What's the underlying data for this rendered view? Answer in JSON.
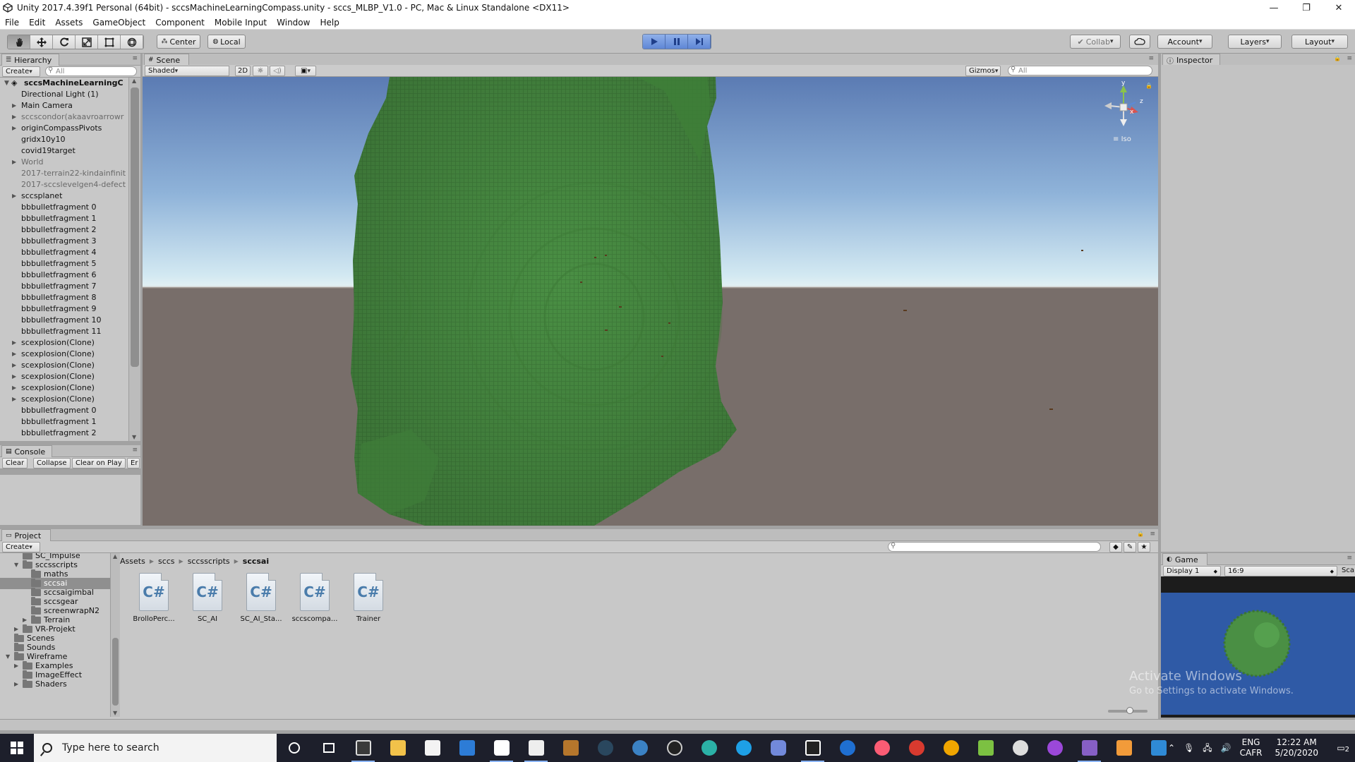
{
  "window": {
    "title": "Unity 2017.4.39f1 Personal (64bit) - sccsMachineLearningCompass.unity - sccs_MLBP_V1.0 - PC, Mac & Linux Standalone <DX11>",
    "minimize": "—",
    "maximize": "❐",
    "close": "✕"
  },
  "menu": [
    "File",
    "Edit",
    "Assets",
    "GameObject",
    "Component",
    "Mobile Input",
    "Window",
    "Help"
  ],
  "toolbar": {
    "pivot": "Center",
    "space": "Local",
    "collab": "Collab",
    "account": "Account",
    "layers": "Layers",
    "layout": "Layout"
  },
  "hierarchy": {
    "tab": "Hierarchy",
    "create": "Create",
    "search_placeholder": "All",
    "root": "sccsMachineLearningC",
    "items": [
      {
        "label": "Directional Light (1)",
        "arrow": "",
        "dim": false
      },
      {
        "label": "Main Camera",
        "arrow": "▶",
        "dim": false
      },
      {
        "label": "sccscondor(akaavroarrowr",
        "arrow": "▶",
        "dim": true
      },
      {
        "label": "originCompassPivots",
        "arrow": "▶",
        "dim": false
      },
      {
        "label": "gridx10y10",
        "arrow": "",
        "dim": false
      },
      {
        "label": "covid19target",
        "arrow": "",
        "dim": false
      },
      {
        "label": "World",
        "arrow": "▶",
        "dim": true
      },
      {
        "label": "2017-terrain22-kindainfinit",
        "arrow": "",
        "dim": true
      },
      {
        "label": "2017-sccslevelgen4-defect",
        "arrow": "",
        "dim": true
      },
      {
        "label": "sccsplanet",
        "arrow": "▶",
        "dim": false
      },
      {
        "label": "bbbulletfragment 0",
        "arrow": "",
        "dim": false
      },
      {
        "label": "bbbulletfragment 1",
        "arrow": "",
        "dim": false
      },
      {
        "label": "bbbulletfragment 2",
        "arrow": "",
        "dim": false
      },
      {
        "label": "bbbulletfragment 3",
        "arrow": "",
        "dim": false
      },
      {
        "label": "bbbulletfragment 4",
        "arrow": "",
        "dim": false
      },
      {
        "label": "bbbulletfragment 5",
        "arrow": "",
        "dim": false
      },
      {
        "label": "bbbulletfragment 6",
        "arrow": "",
        "dim": false
      },
      {
        "label": "bbbulletfragment 7",
        "arrow": "",
        "dim": false
      },
      {
        "label": "bbbulletfragment 8",
        "arrow": "",
        "dim": false
      },
      {
        "label": "bbbulletfragment 9",
        "arrow": "",
        "dim": false
      },
      {
        "label": "bbbulletfragment 10",
        "arrow": "",
        "dim": false
      },
      {
        "label": "bbbulletfragment 11",
        "arrow": "",
        "dim": false
      },
      {
        "label": "scexplosion(Clone)",
        "arrow": "▶",
        "dim": false
      },
      {
        "label": "scexplosion(Clone)",
        "arrow": "▶",
        "dim": false
      },
      {
        "label": "scexplosion(Clone)",
        "arrow": "▶",
        "dim": false
      },
      {
        "label": "scexplosion(Clone)",
        "arrow": "▶",
        "dim": false
      },
      {
        "label": "scexplosion(Clone)",
        "arrow": "▶",
        "dim": false
      },
      {
        "label": "scexplosion(Clone)",
        "arrow": "▶",
        "dim": false
      },
      {
        "label": "bbbulletfragment 0",
        "arrow": "",
        "dim": false
      },
      {
        "label": "bbbulletfragment 1",
        "arrow": "",
        "dim": false
      },
      {
        "label": "bbbulletfragment 2",
        "arrow": "",
        "dim": false
      }
    ]
  },
  "console": {
    "tab": "Console",
    "buttons": [
      "Clear",
      "Collapse",
      "Clear on Play",
      "Er"
    ]
  },
  "scene": {
    "tab": "Scene",
    "shading": "Shaded",
    "mode2d": "2D",
    "gizmos": "Gizmos",
    "search_placeholder": "All",
    "projection": "Iso",
    "axis_y": "y",
    "axis_x": "x",
    "axis_z": "z"
  },
  "inspector": {
    "tab": "Inspector"
  },
  "project": {
    "tab": "Project",
    "create": "Create",
    "tree": [
      {
        "label": "SC_Impulse",
        "indent": 2,
        "arrow": "",
        "selected": false
      },
      {
        "label": "sccsscripts",
        "indent": 2,
        "arrow": "▼",
        "selected": false
      },
      {
        "label": "maths",
        "indent": 3,
        "arrow": "",
        "selected": false
      },
      {
        "label": "sccsai",
        "indent": 3,
        "arrow": "",
        "selected": true
      },
      {
        "label": "sccsaigimbal",
        "indent": 3,
        "arrow": "",
        "selected": false
      },
      {
        "label": "sccsgear",
        "indent": 3,
        "arrow": "",
        "selected": false
      },
      {
        "label": "screenwrapN2",
        "indent": 3,
        "arrow": "",
        "selected": false
      },
      {
        "label": "Terrain",
        "indent": 3,
        "arrow": "▶",
        "selected": false
      },
      {
        "label": "VR-Projekt",
        "indent": 2,
        "arrow": "▶",
        "selected": false
      },
      {
        "label": "Scenes",
        "indent": 1,
        "arrow": "",
        "selected": false
      },
      {
        "label": "Sounds",
        "indent": 1,
        "arrow": "",
        "selected": false
      },
      {
        "label": "Wireframe",
        "indent": 1,
        "arrow": "▼",
        "selected": false
      },
      {
        "label": "Examples",
        "indent": 2,
        "arrow": "▶",
        "selected": false
      },
      {
        "label": "ImageEffect",
        "indent": 2,
        "arrow": "",
        "selected": false
      },
      {
        "label": "Shaders",
        "indent": 2,
        "arrow": "▶",
        "selected": false
      }
    ],
    "breadcrumb": [
      "Assets",
      "sccs",
      "sccsscripts",
      "sccsai"
    ],
    "assets": [
      "BrolloPerc...",
      "SC_AI",
      "SC_AI_Sta...",
      "sccscompa...",
      "Trainer"
    ],
    "asset_icon": "C#"
  },
  "game": {
    "tab": "Game",
    "display": "Display 1",
    "aspect": "16:9",
    "scale_label": "Sca"
  },
  "watermark": {
    "line1": "Activate Windows",
    "line2": "Go to Settings to activate Windows."
  },
  "taskbar": {
    "search_placeholder": "Type here to search",
    "lang_top": "ENG",
    "lang_bottom": "CAFR",
    "time": "12:22 AM",
    "date": "5/20/2020",
    "notifications": "2"
  },
  "colors": {
    "voxel_green": "#4a8f44",
    "sky_top": "#5b7bb3",
    "horizon": "#cfe6f2",
    "ground": "#786e6a",
    "play_blue": "#5e86d6"
  }
}
